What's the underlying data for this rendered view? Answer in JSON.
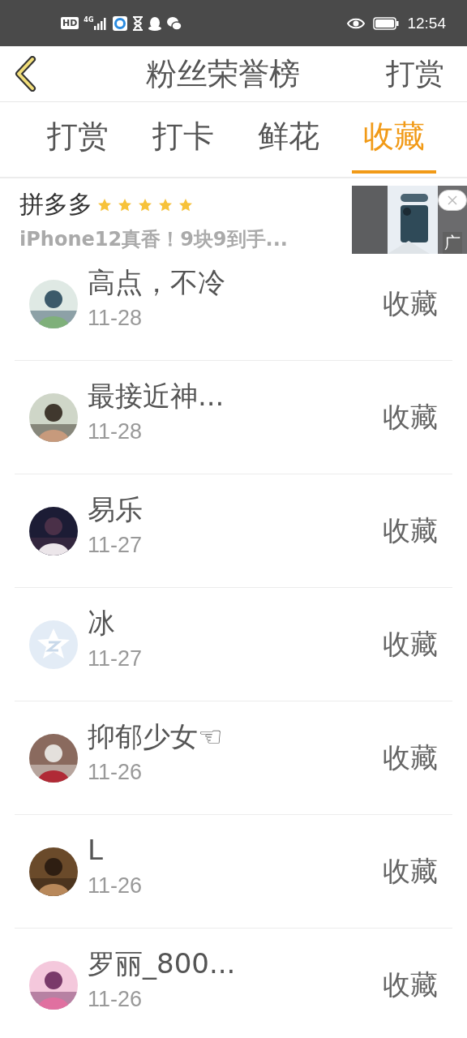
{
  "status_bar": {
    "time": "12:54",
    "network": "4G",
    "hd": "HD"
  },
  "header": {
    "title": "粉丝荣誉榜",
    "action": "打赏"
  },
  "tabs": [
    {
      "label": "打赏",
      "selected": false
    },
    {
      "label": "打卡",
      "selected": false
    },
    {
      "label": "鲜花",
      "selected": false
    },
    {
      "label": "收藏",
      "selected": true
    }
  ],
  "ad": {
    "title": "拼多多",
    "stars": 5,
    "text": "iPhone12真香！9块9到手...",
    "badge": "广"
  },
  "fans": [
    {
      "name": "高点，不冷",
      "date": "11-28",
      "action": "收藏"
    },
    {
      "name": "最接近神...",
      "date": "11-28",
      "action": "收藏"
    },
    {
      "name": "易乐",
      "date": "11-27",
      "action": "收藏"
    },
    {
      "name": "冰",
      "date": "11-27",
      "action": "收藏",
      "avatar": {
        "kind": "default"
      }
    },
    {
      "name": "抑郁少女☜",
      "date": "11-26",
      "action": "收藏"
    },
    {
      "name": "L",
      "date": "11-26",
      "action": "收藏"
    },
    {
      "name": "罗丽_800...",
      "date": "11-26",
      "action": "收藏"
    }
  ]
}
